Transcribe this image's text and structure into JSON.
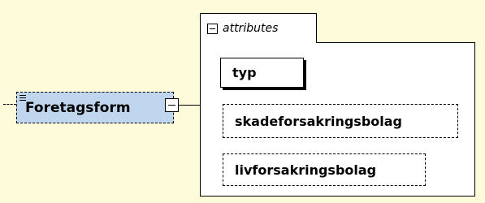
{
  "element": {
    "name": "Foretagsform"
  },
  "group": {
    "label": "attributes"
  },
  "attributes": [
    {
      "name": "typ",
      "required": true
    },
    {
      "name": "skadeforsakringsbolag",
      "required": false
    },
    {
      "name": "livforsakringsbolag",
      "required": false
    }
  ]
}
